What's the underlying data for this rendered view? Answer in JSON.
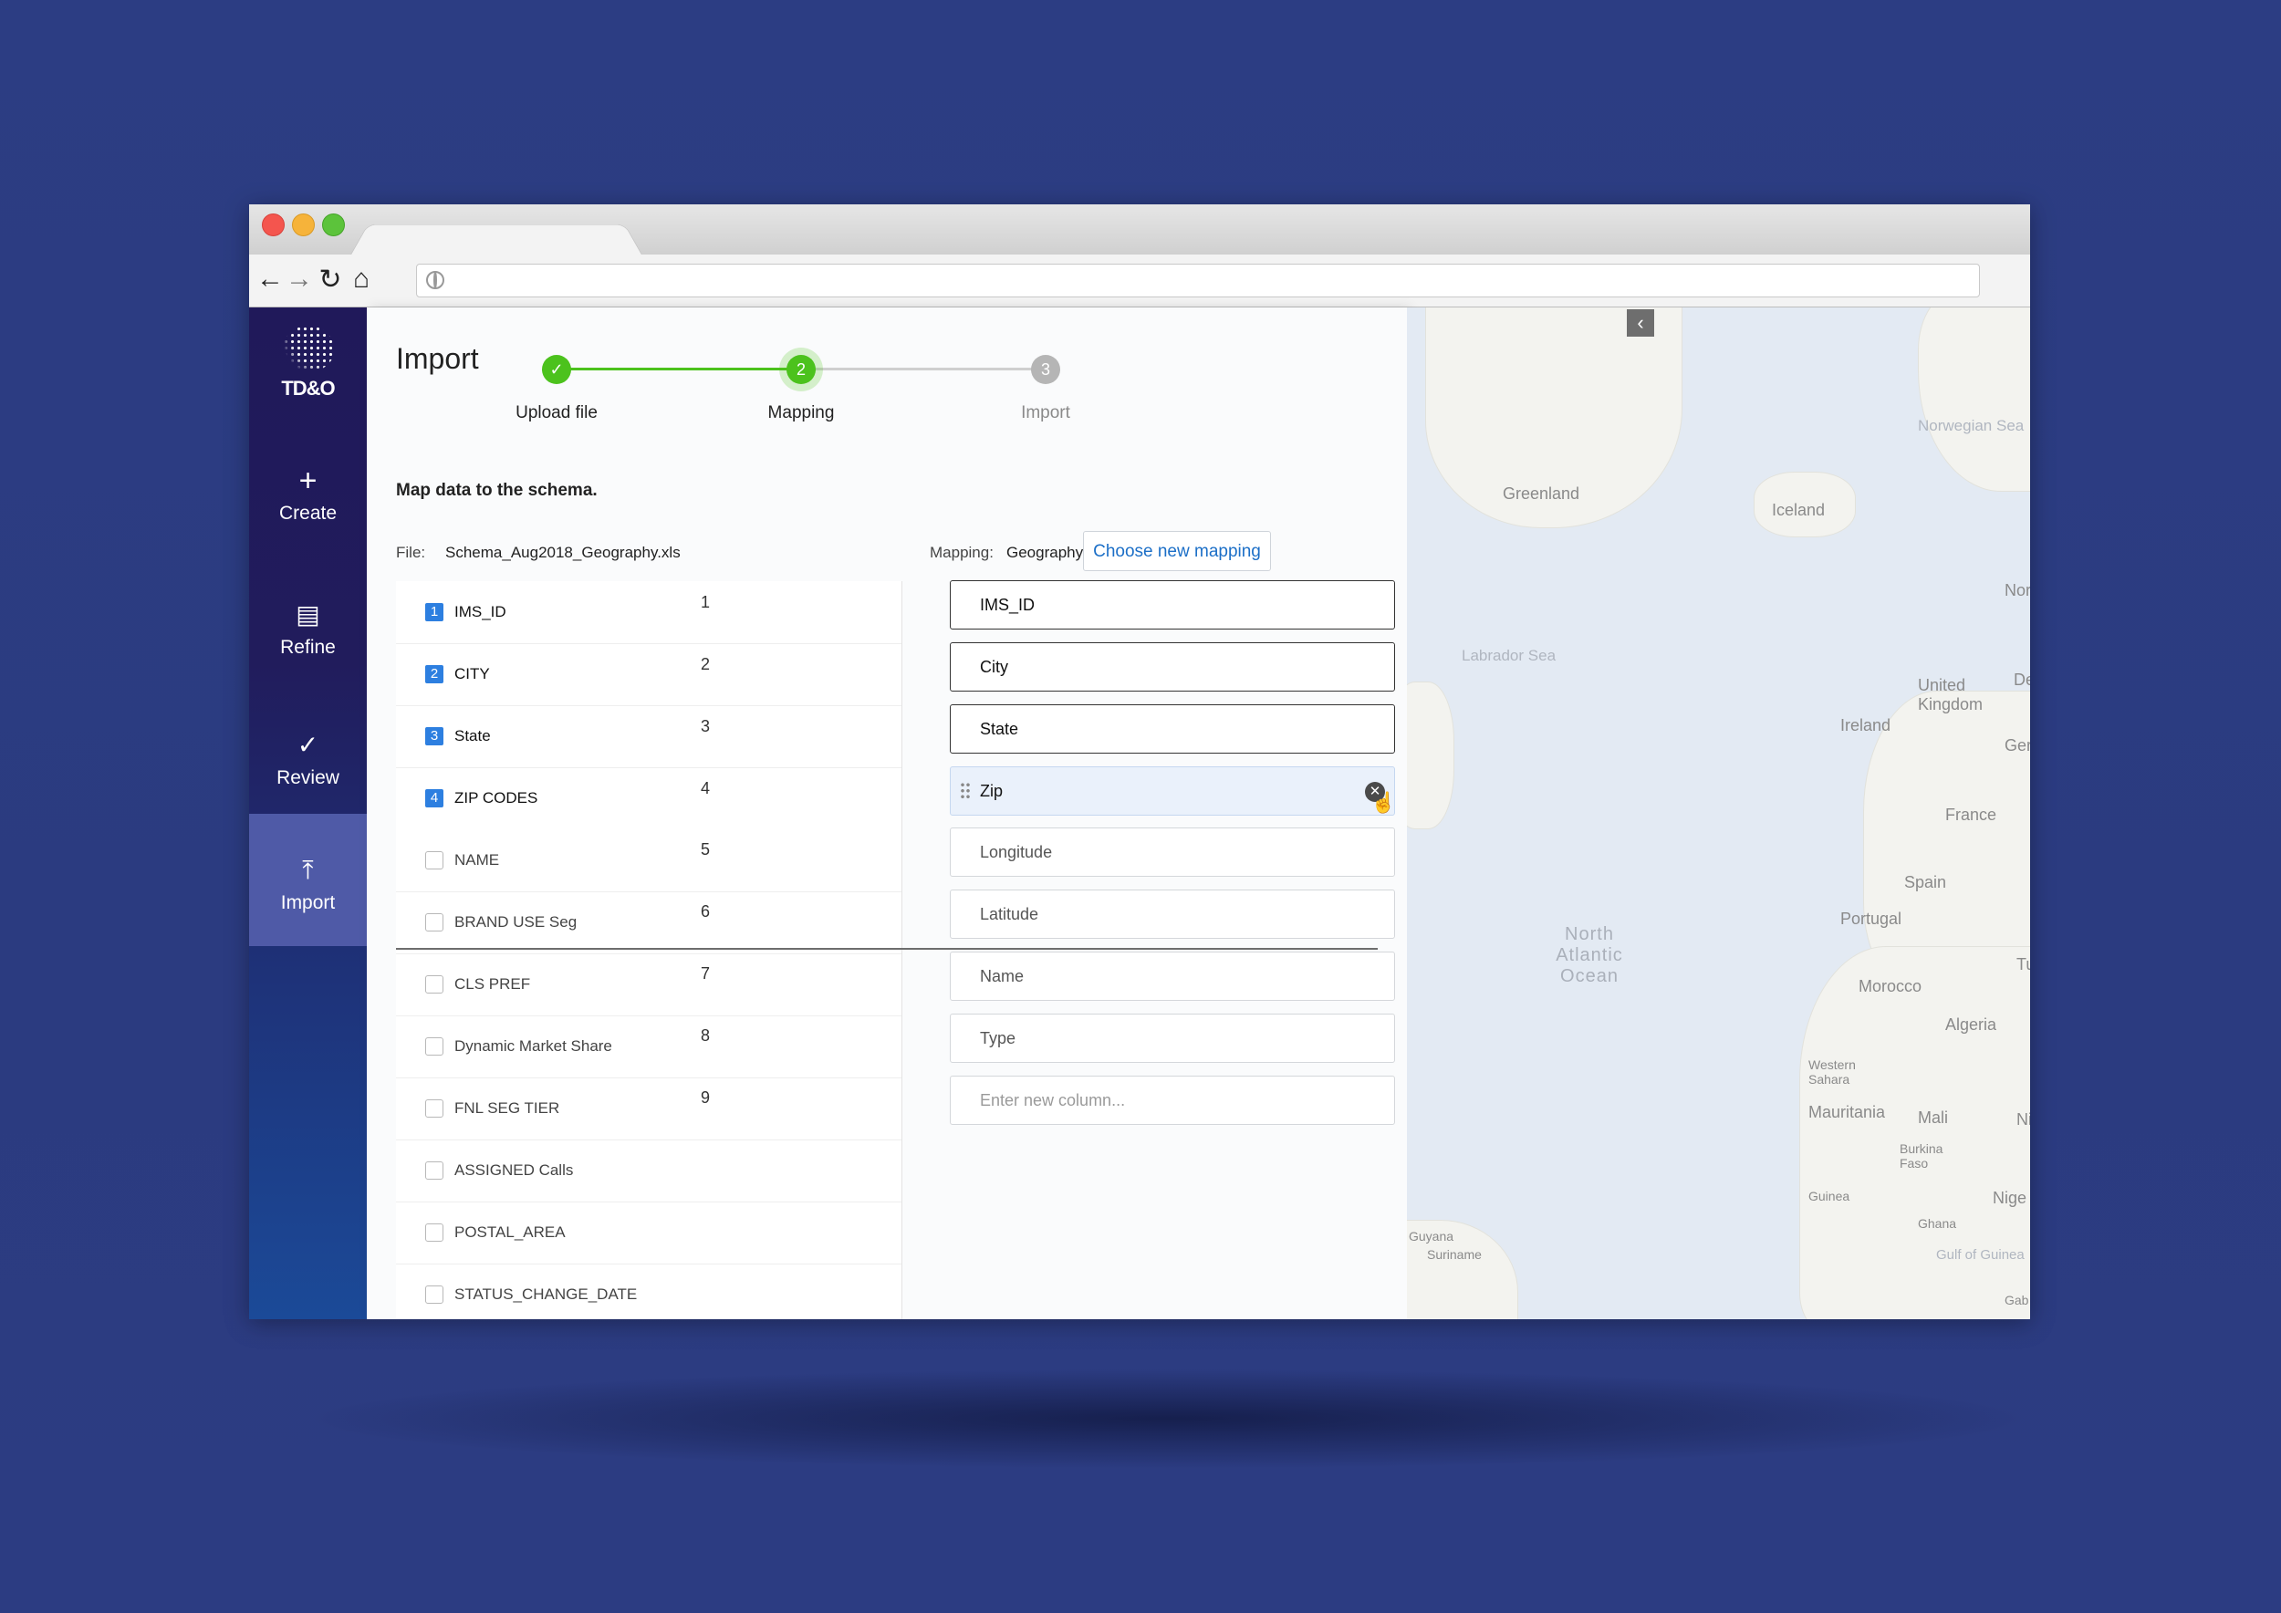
{
  "header": {
    "title": "Import",
    "steps": [
      {
        "label": "Upload file",
        "marker": "✓",
        "state": "done"
      },
      {
        "label": "Mapping",
        "marker": "2",
        "state": "current"
      },
      {
        "label": "Import",
        "marker": "3",
        "state": "todo"
      }
    ]
  },
  "sidebar": {
    "logo": "TD&O",
    "items": [
      {
        "label": "Create",
        "icon": "+"
      },
      {
        "label": "Refine",
        "icon": "▤"
      },
      {
        "label": "Review",
        "icon": "✓"
      },
      {
        "label": "Import",
        "icon": "⤒"
      }
    ]
  },
  "mapping": {
    "subtitle": "Map data to the schema.",
    "file_label": "File:",
    "file_name": "Schema_Aug2018_Geography.xls",
    "mapping_label": "Mapping:",
    "mapping_name": "Geography",
    "choose_button": "Choose new mapping",
    "source_columns": [
      {
        "badge": "1",
        "name": "IMS_ID",
        "mapped": true
      },
      {
        "badge": "2",
        "name": "CITY",
        "mapped": true
      },
      {
        "badge": "3",
        "name": "State",
        "mapped": true
      },
      {
        "badge": "4",
        "name": "ZIP CODES",
        "mapped": true
      },
      {
        "name": "NAME",
        "mapped": false
      },
      {
        "name": "BRAND USE Seg",
        "mapped": false
      },
      {
        "name": "CLS PREF",
        "mapped": false
      },
      {
        "name": "Dynamic Market Share",
        "mapped": false
      },
      {
        "name": "FNL SEG TIER",
        "mapped": false
      },
      {
        "name": "ASSIGNED Calls",
        "mapped": false
      },
      {
        "name": "POSTAL_AREA",
        "mapped": false
      },
      {
        "name": "STATUS_CHANGE_DATE",
        "mapped": false
      }
    ],
    "target_columns": [
      {
        "num": "1",
        "value": "IMS_ID",
        "state": "mapped"
      },
      {
        "num": "2",
        "value": "City",
        "state": "mapped"
      },
      {
        "num": "3",
        "value": "State",
        "state": "mapped"
      },
      {
        "num": "4",
        "value": "Zip",
        "state": "active"
      },
      {
        "num": "5",
        "value": "Longitude",
        "state": "plain"
      },
      {
        "num": "6",
        "value": "Latitude",
        "state": "plain"
      },
      {
        "num": "7",
        "value": "Name",
        "state": "plain"
      },
      {
        "num": "8",
        "value": "Type",
        "state": "plain"
      },
      {
        "num": "9",
        "placeholder": "Enter new column...",
        "state": "placeholder"
      }
    ]
  },
  "map": {
    "labels": [
      "Greenland",
      "Iceland",
      "Norwegian Sea",
      "Labrador Sea",
      "Nor",
      "United Kingdom",
      "Ireland",
      "De",
      "Ger",
      "France",
      "Spain",
      "Portugal",
      "North Atlantic Ocean",
      "Tu",
      "Morocco",
      "Algeria",
      "Western Sahara",
      "Mauritania",
      "Mali",
      "Ni",
      "Burkina Faso",
      "Guinea",
      "Ghana",
      "Nige",
      "Gulf of Guinea",
      "Guyana",
      "Suriname",
      "Gab"
    ]
  },
  "colors": {
    "background": "#2c3d83",
    "sidebar": "#211c5c",
    "accent_green": "#4cc21d",
    "badge_blue": "#2d7fe0",
    "link_blue": "#1c6fc7"
  }
}
